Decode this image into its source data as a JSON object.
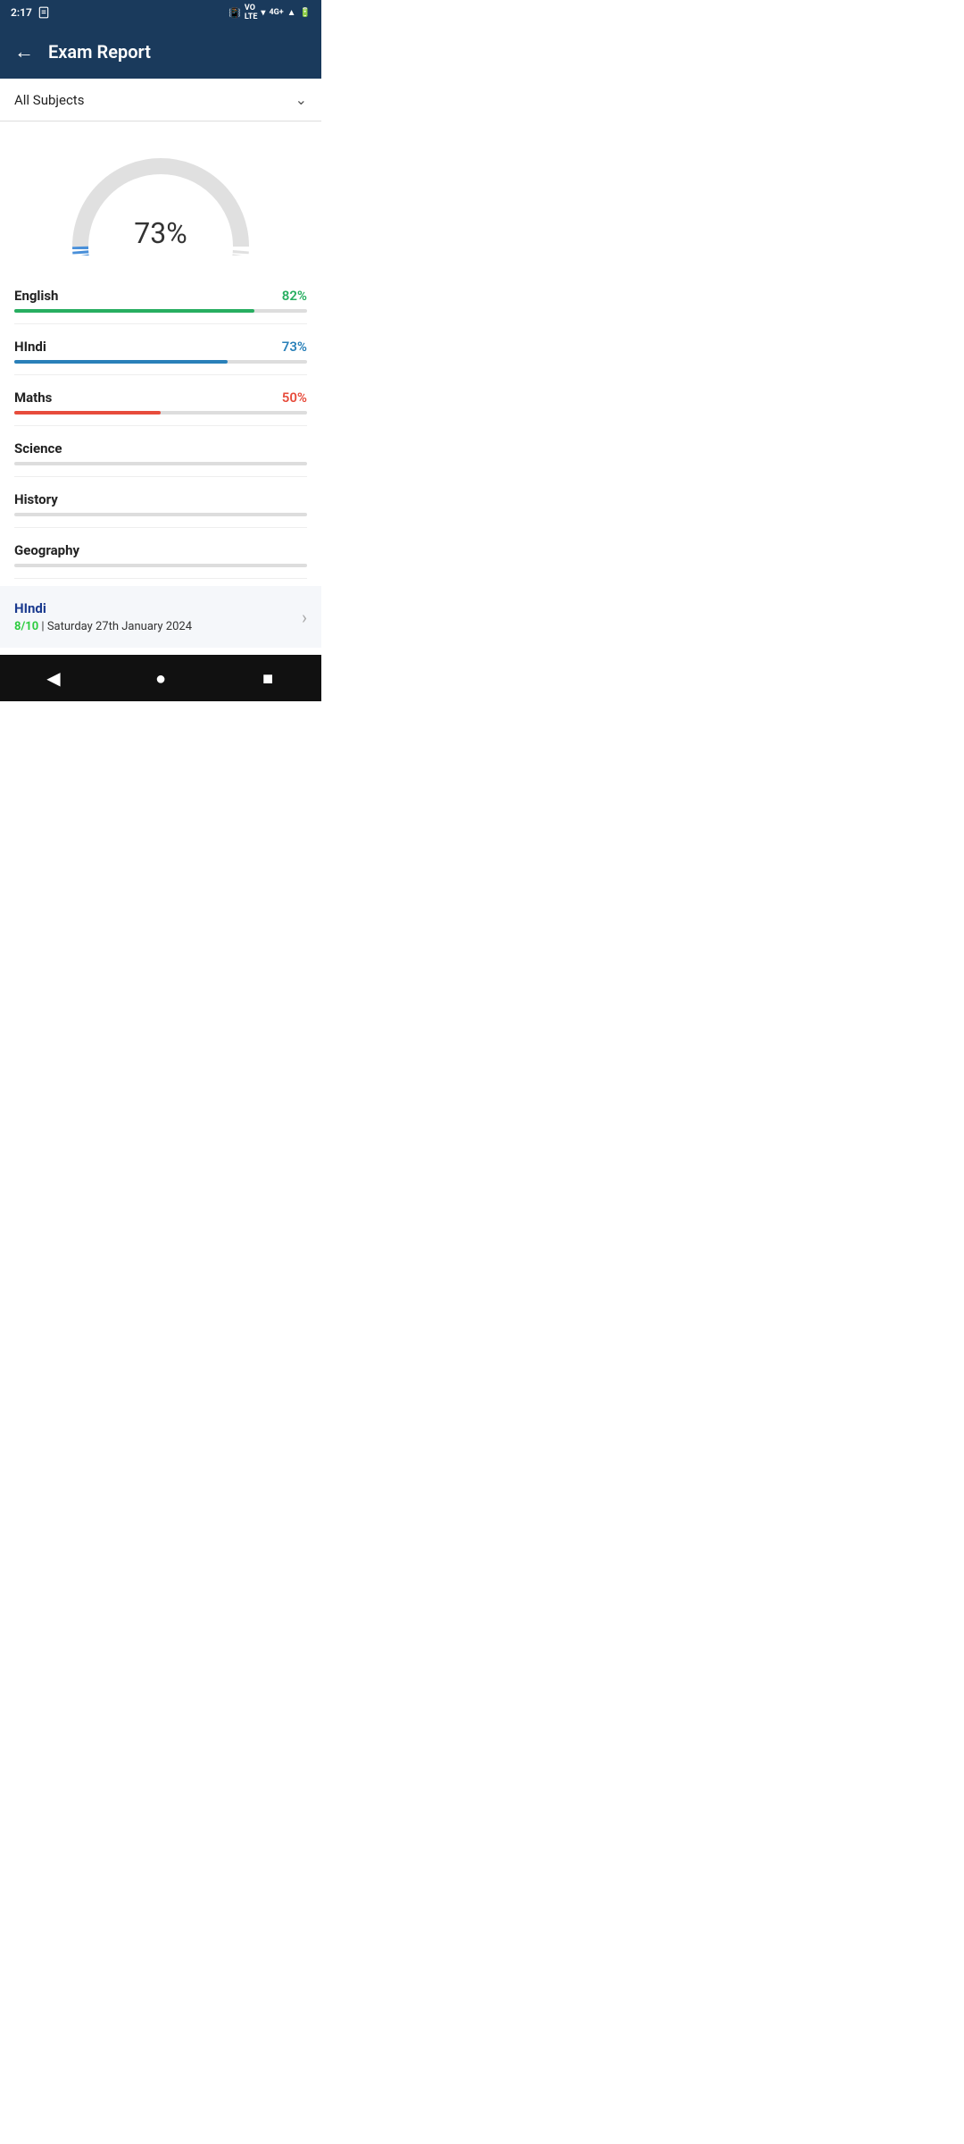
{
  "status": {
    "time": "2:17",
    "icons_right": "▣ VO LTE ▼ 4G+ ▲ 🔋"
  },
  "header": {
    "back_icon": "←",
    "title": "Exam Report"
  },
  "dropdown": {
    "label": "All Subjects",
    "chevron": "⌄"
  },
  "gauge": {
    "value": "73%",
    "percent": 73,
    "color": "#4a90d9"
  },
  "subjects": [
    {
      "name": "English",
      "percent": 82,
      "display": "82%",
      "color": "#27ae60",
      "has_data": true
    },
    {
      "name": "HIndi",
      "percent": 73,
      "display": "73%",
      "color": "#2980b9",
      "has_data": true
    },
    {
      "name": "Maths",
      "percent": 50,
      "display": "50%",
      "color": "#e74c3c",
      "has_data": true
    },
    {
      "name": "Science",
      "percent": 0,
      "display": "",
      "color": "#ccc",
      "has_data": false
    },
    {
      "name": "History",
      "percent": 0,
      "display": "",
      "color": "#ccc",
      "has_data": false
    },
    {
      "name": "Geography",
      "percent": 0,
      "display": "",
      "color": "#ccc",
      "has_data": false
    }
  ],
  "recent_exam": {
    "title": "HIndi",
    "score": "8/10",
    "date": "Saturday 27th January 2024",
    "separator": " | "
  },
  "nav": {
    "back": "◀",
    "home": "●",
    "square": "■"
  }
}
